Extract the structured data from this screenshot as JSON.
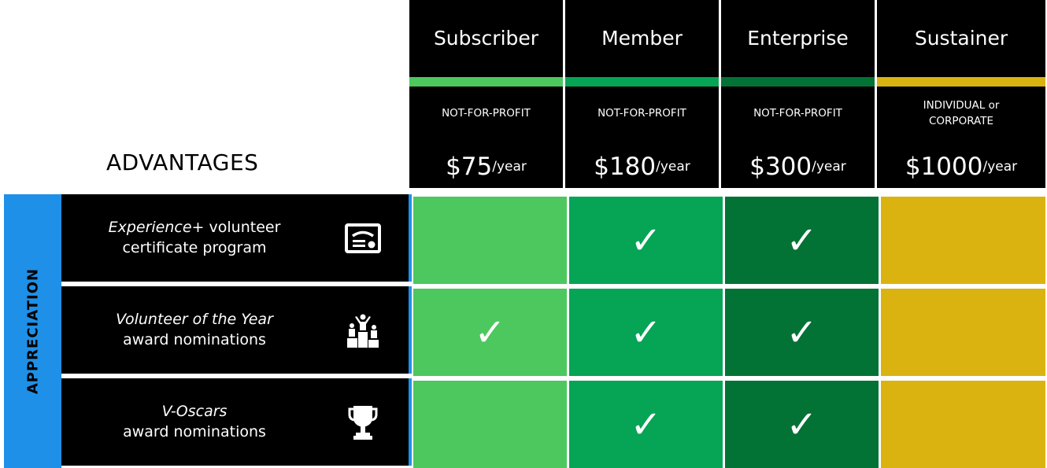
{
  "colors": {
    "subscriber": "#4cc85e",
    "member": "#06a455",
    "enterprise": "#037235",
    "sustainer": "#dbb310",
    "category": "#1e90e8",
    "black": "#000000"
  },
  "tiers": [
    {
      "name": "Subscriber",
      "kind": "NOT-FOR-PROFIT",
      "price": "$75",
      "per": "/year"
    },
    {
      "name": "Member",
      "kind": "NOT-FOR-PROFIT",
      "price": "$180",
      "per": "/year"
    },
    {
      "name": "Enterprise",
      "kind": "NOT-FOR-PROFIT",
      "price": "$300",
      "per": "/year"
    },
    {
      "name": "Sustainer",
      "kind": "INDIVIDUAL or CORPORATE",
      "price": "$1000",
      "per": "/year"
    }
  ],
  "advantages_heading": "ADVANTAGES",
  "category": "APPRECIATION",
  "features": [
    {
      "emphasis": "Experience+",
      "line1_rest": " volunteer",
      "line2": "certificate program",
      "icon": "certificate-icon",
      "checks": [
        false,
        true,
        true,
        false
      ]
    },
    {
      "emphasis": "Volunteer of the Year",
      "line1_rest": "",
      "line2": "award nominations",
      "icon": "podium-icon",
      "checks": [
        true,
        true,
        true,
        false
      ]
    },
    {
      "emphasis": "V-Oscars",
      "line1_rest": "",
      "line2": "award nominations",
      "icon": "trophy-icon",
      "checks": [
        false,
        true,
        true,
        false
      ]
    }
  ],
  "check_mark": "✓"
}
